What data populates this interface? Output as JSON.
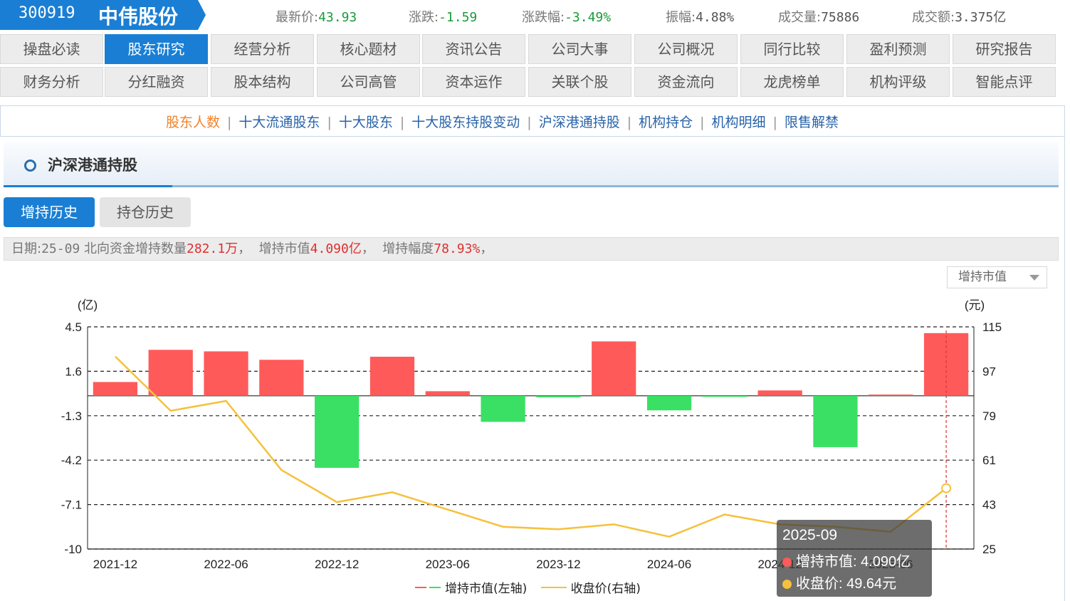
{
  "stock": {
    "code": "300919",
    "name": "中伟股份",
    "quotes": [
      {
        "label": "最新价:",
        "value": "43.93",
        "style": "green"
      },
      {
        "label": "涨跌:",
        "value": "-1.59",
        "style": "green"
      },
      {
        "label": "涨跌幅:",
        "value": "-3.49%",
        "style": "green"
      },
      {
        "label": "振幅:",
        "value": "4.88%",
        "style": "neutral"
      },
      {
        "label": "成交量:",
        "value": "75886",
        "style": "neutral"
      },
      {
        "label": "成交额:",
        "value": "3.375亿",
        "style": "neutral"
      }
    ]
  },
  "nav": {
    "row1": [
      "操盘必读",
      "股东研究",
      "经营分析",
      "核心题材",
      "资讯公告",
      "公司大事",
      "公司概况",
      "同行比较",
      "盈利预测",
      "研究报告"
    ],
    "row2": [
      "财务分析",
      "分红融资",
      "股本结构",
      "公司高管",
      "资本运作",
      "关联个股",
      "资金流向",
      "龙虎榜单",
      "机构评级",
      "智能点评"
    ],
    "active": "股东研究"
  },
  "sub_nav": {
    "items": [
      "股东人数",
      "十大流通股东",
      "十大股东",
      "十大股东持股变动",
      "沪深港通持股",
      "机构持仓",
      "机构明细",
      "限售解禁"
    ],
    "separator": "|",
    "active": "股东人数"
  },
  "section": {
    "title": "沪深港通持股"
  },
  "tabs": {
    "history": "增持历史",
    "holdings": "持仓历史"
  },
  "info": {
    "date_label": "日期:",
    "date": "25-09",
    "qty_label": "北向资金增持数量",
    "qty": "282.1万",
    "mv_label": "增持市值",
    "mv": "4.090亿",
    "pct_label": "增持幅度",
    "pct": "78.93%",
    "punct": "，"
  },
  "dropdown": {
    "selected": "增持市值"
  },
  "chart_data": {
    "type": "bar+line",
    "left_axis": {
      "unit": "(亿)",
      "ticks": [
        "4.5",
        "1.6",
        "-1.3",
        "-4.2",
        "-7.1",
        "-10"
      ],
      "range": [
        -10,
        4.5
      ]
    },
    "right_axis": {
      "unit": "(元)",
      "ticks": [
        "115",
        "97",
        "79",
        "61",
        "43",
        "25"
      ],
      "range": [
        25,
        115
      ]
    },
    "x_tick_labels": [
      "2021-12",
      "2022-06",
      "2022-12",
      "2023-06",
      "2023-12",
      "2024-06",
      "2024-12",
      "2025-06"
    ],
    "x_periods": [
      "2021-12",
      "2022-03",
      "2022-06",
      "2022-09",
      "2022-12",
      "2023-03",
      "2023-06",
      "2023-09",
      "2023-12",
      "2024-03",
      "2024-06",
      "2024-09",
      "2024-12",
      "2025-03",
      "2025-06",
      "2025-09"
    ],
    "series": [
      {
        "name": "增持市值(左轴)",
        "kind": "bar",
        "values": [
          0.9,
          3.0,
          2.9,
          2.35,
          -4.7,
          2.55,
          0.3,
          -1.7,
          -0.1,
          3.55,
          -0.95,
          -0.05,
          0.35,
          -3.35,
          0.08,
          4.09
        ],
        "pos_color": "#ff5a5a",
        "neg_color": "#3ae064"
      },
      {
        "name": "收盘价(右轴)",
        "kind": "line",
        "values": [
          103,
          81,
          85,
          57,
          44,
          48,
          41,
          34,
          33,
          35,
          30,
          39,
          35,
          34,
          32,
          49.64
        ],
        "color": "#f5c13c"
      }
    ],
    "highlight_index": 15
  },
  "tooltip": {
    "date": "2025-09",
    "mv_label": "增持市值:",
    "mv_value": "4.090亿",
    "price_label": "收盘价:",
    "price_value": "49.64元"
  },
  "legend": {
    "bar": "增持市值(左轴)",
    "line": "收盘价(右轴)"
  }
}
